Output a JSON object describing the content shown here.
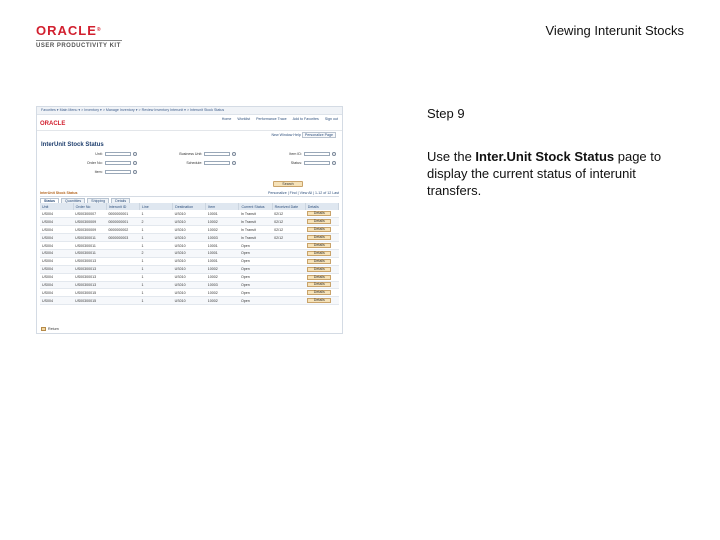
{
  "header": {
    "logo_word": "ORACLE",
    "logo_registered": "®",
    "logo_sub": "USER PRODUCTIVITY KIT",
    "title": "Viewing Interunit Stocks"
  },
  "step": {
    "number_label": "Step 9",
    "instruction_prefix": "Use the ",
    "instruction_bold": "Inter.Unit Stock Status",
    "instruction_suffix": " page to display the current status of interunit transfers."
  },
  "screenshot": {
    "breadcrumb": "Favorites  ▾  Main Menu  ▾  > Inventory  ▾  > Manage Inventory  ▾  > Review Inventory Interunit  ▾  > Interunit Stock Status",
    "brand": "ORACLE",
    "top_nav": [
      "Home",
      "Worklist",
      "Performance Trace",
      "Add to Favorites",
      "Sign out"
    ],
    "sub_nav": [
      "New Window",
      "Help",
      "Personalize Page"
    ],
    "page_heading": "InterUnit Stock Status",
    "criteria": [
      {
        "label": "Unit:",
        "value": ""
      },
      {
        "label": "Business Unit:",
        "value": ""
      },
      {
        "label": "Item ID:",
        "value": ""
      },
      {
        "label": "Order No:",
        "value": ""
      },
      {
        "label": "Schedule:",
        "value": ""
      },
      {
        "label": "Status:",
        "value": ""
      },
      {
        "label": "Item:",
        "value": ""
      }
    ],
    "search_label": "Search",
    "grid_title": "InterUnit Stock Status",
    "grid_nav": "Personalize | Find | View All | 1-12 of 12 Last",
    "tabs": [
      "Status",
      "Quantities",
      "Shipping",
      "Details"
    ],
    "columns": [
      "Unit",
      "Order No",
      "Interunit ID",
      "Line",
      "Destination",
      "Item",
      "Current Status",
      "Received Date",
      "Details"
    ],
    "rows": [
      [
        "US004",
        "US00300007",
        "0000000001",
        "1",
        "US010",
        "10001",
        "In Transit",
        "02/12",
        "Details"
      ],
      [
        "US004",
        "US00300009",
        "0000000001",
        "2",
        "US010",
        "10002",
        "In Transit",
        "02/12",
        "Details"
      ],
      [
        "US004",
        "US00300009",
        "0000000002",
        "1",
        "US010",
        "10002",
        "In Transit",
        "02/12",
        "Details"
      ],
      [
        "US004",
        "US00300011",
        "0000000003",
        "1",
        "US010",
        "10003",
        "In Transit",
        "02/12",
        "Details"
      ],
      [
        "US004",
        "US00300011",
        "",
        "1",
        "US010",
        "10001",
        "Open",
        "",
        "Details"
      ],
      [
        "US004",
        "US00300011",
        "",
        "2",
        "US010",
        "10001",
        "Open",
        "",
        "Details"
      ],
      [
        "US004",
        "US00300013",
        "",
        "1",
        "US010",
        "10001",
        "Open",
        "",
        "Details"
      ],
      [
        "US004",
        "US00300013",
        "",
        "1",
        "US010",
        "10002",
        "Open",
        "",
        "Details"
      ],
      [
        "US004",
        "US00300013",
        "",
        "1",
        "US010",
        "10002",
        "Open",
        "",
        "Details"
      ],
      [
        "US004",
        "US00300013",
        "",
        "1",
        "US010",
        "10003",
        "Open",
        "",
        "Details"
      ],
      [
        "US004",
        "US00300015",
        "",
        "1",
        "US010",
        "10002",
        "Open",
        "",
        "Details"
      ],
      [
        "US004",
        "US00300015",
        "",
        "1",
        "US010",
        "10002",
        "Open",
        "",
        "Details"
      ]
    ],
    "return_label": "Return"
  }
}
